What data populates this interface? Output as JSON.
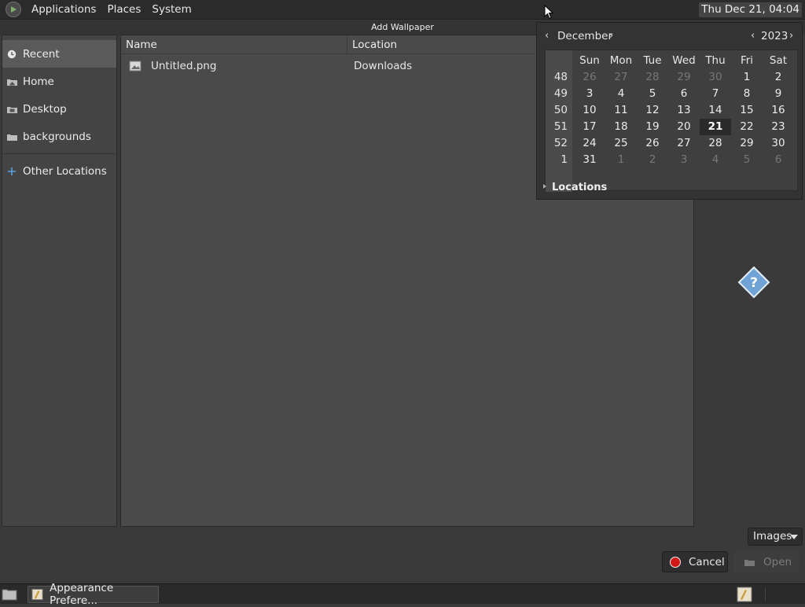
{
  "top_panel": {
    "menus": [
      "Applications",
      "Places",
      "System"
    ],
    "clock": "Thu Dec 21, 04:04"
  },
  "dialog": {
    "title": "Add Wallpaper",
    "sidebar": [
      {
        "label": "Recent",
        "icon": "recent-icon",
        "active": true
      },
      {
        "label": "Home",
        "icon": "home-folder-icon"
      },
      {
        "label": "Desktop",
        "icon": "desktop-folder-icon"
      },
      {
        "label": "backgrounds",
        "icon": "folder-icon"
      },
      {
        "label": "Other Locations",
        "icon": "plus-icon"
      }
    ],
    "columns": {
      "name": "Name",
      "location": "Location"
    },
    "files": [
      {
        "name": "Untitled.png",
        "location": "Downloads",
        "icon": "image-file-icon"
      }
    ],
    "filter": "Images",
    "cancel_label": "Cancel",
    "open_label": "Open"
  },
  "calendar": {
    "month": "December",
    "year": "2023",
    "weekdays": [
      "Sun",
      "Mon",
      "Tue",
      "Wed",
      "Thu",
      "Fri",
      "Sat"
    ],
    "weeks": [
      {
        "wk": "48",
        "days": [
          "26",
          "27",
          "28",
          "29",
          "30",
          "1",
          "2"
        ]
      },
      {
        "wk": "49",
        "days": [
          "3",
          "4",
          "5",
          "6",
          "7",
          "8",
          "9"
        ]
      },
      {
        "wk": "50",
        "days": [
          "10",
          "11",
          "12",
          "13",
          "14",
          "15",
          "16"
        ]
      },
      {
        "wk": "51",
        "days": [
          "17",
          "18",
          "19",
          "20",
          "21",
          "22",
          "23"
        ]
      },
      {
        "wk": "52",
        "days": [
          "24",
          "25",
          "26",
          "27",
          "28",
          "29",
          "30"
        ]
      },
      {
        "wk": "1",
        "days": [
          "31",
          "1",
          "2",
          "3",
          "4",
          "5",
          "6"
        ]
      }
    ],
    "today": "21",
    "locations_label": "Locations"
  },
  "taskbar": {
    "task_label": "Appearance Prefere..."
  },
  "colors": {
    "panel_bg": "#2b2b2b",
    "pane_bg": "#4a4a4a",
    "cancel_red": "#d31818"
  }
}
